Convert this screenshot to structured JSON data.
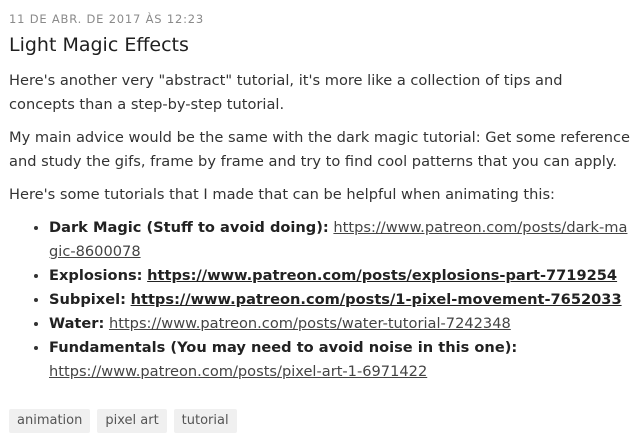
{
  "post": {
    "date": "11 DE ABR. DE 2017 ÀS 12:23",
    "title": "Light Magic Effects",
    "paragraphs": [
      "Here's another very \"abstract\" tutorial, it's more like a collection of tips and concepts than a step-by-step tutorial.",
      "My main advice would be the same with the dark magic tutorial: Get some reference and study the gifs, frame by frame and try to find cool patterns that you can apply.",
      "Here's some tutorials that I made that can be helpful when animating this:"
    ],
    "links": [
      {
        "label": "Dark Magic (Stuff to avoid doing):",
        "url": "https://www.patreon.com/posts/dark-magic-8600078"
      },
      {
        "label": "Explosions:",
        "url": "https://www.patreon.com/posts/explosions-part-7719254"
      },
      {
        "label": "Subpixel:",
        "url": "https://www.patreon.com/posts/1-pixel-movement-7652033"
      },
      {
        "label": "Water:",
        "url": "https://www.patreon.com/posts/water-tutorial-7242348"
      },
      {
        "label": "Fundamentals (You may need to avoid noise in this one):",
        "url": "https://www.patreon.com/posts/pixel-art-1-6971422"
      }
    ],
    "tags": [
      "animation",
      "pixel art",
      "tutorial"
    ]
  }
}
